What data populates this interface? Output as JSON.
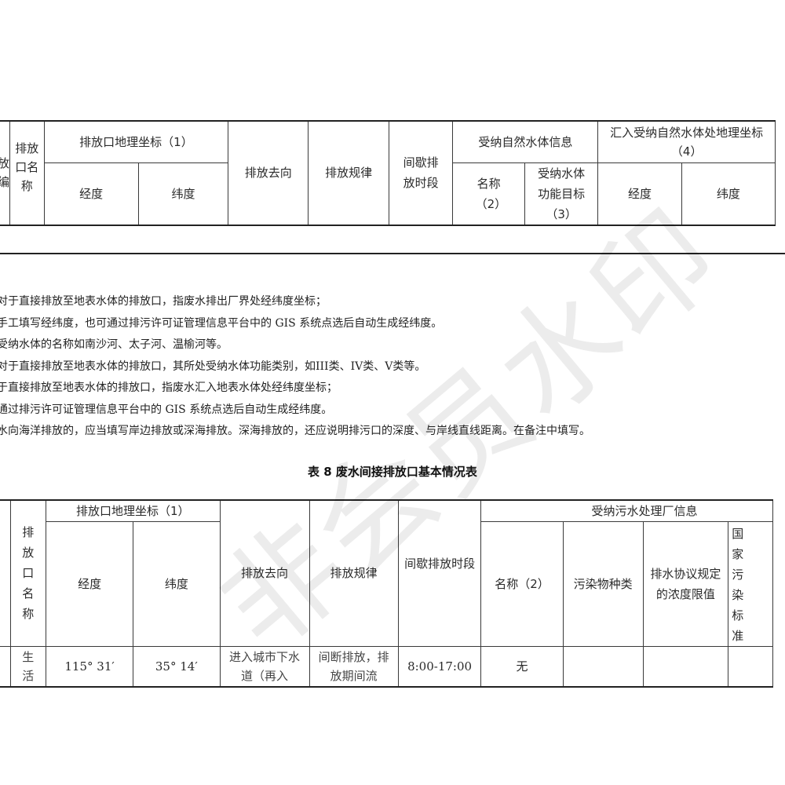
{
  "table7": {
    "headers": {
      "col_partial_number": "放编",
      "outlet_name": "排放口名称",
      "coords_group": "排放口地理坐标（1）",
      "longitude": "经度",
      "latitude": "纬度",
      "destination": "排放去向",
      "pattern": "排放规律",
      "intermittent_period": "间歇排放时段",
      "receiving_water_group": "受纳自然水体信息",
      "receiving_name": "名称（2）",
      "receiving_function": "受纳水体功能目标（3）",
      "inflow_coords_group": "汇入受纳自然水体处地理坐标（4）",
      "inflow_longitude": "经度",
      "inflow_latitude": "纬度"
    }
  },
  "notes": [
    "对于直接排放至地表水体的排放口，指废水排出厂界处经纬度坐标；",
    "手工填写经纬度，也可通过排污许可证管理信息平台中的 GIS 系统点选后自动生成经纬度。",
    "受纳水体的名称如南沙河、太子河、温榆河等。",
    "对于直接排放至地表水体的排放口，其所处受纳水体功能类别，如III类、IV类、V类等。",
    "于直接排放至地表水体的排放口，指废水汇入地表水体处经纬度坐标；",
    "通过排污许可证管理信息平台中的 GIS 系统点选后自动生成经纬度。",
    "水向海洋排放的，应当填写岸边排放或深海排放。深海排放的，还应说明排污口的深度、与岸线直线距离。在备注中填写。"
  ],
  "table8": {
    "caption": "表 8  废水间接排放口基本情况表",
    "headers": {
      "outlet_name": "排放口名称",
      "coords_group": "排放口地理坐标（1）",
      "longitude": "经度",
      "latitude": "纬度",
      "destination": "排放去向",
      "pattern": "排放规律",
      "intermittent_period": "间歇排放时段",
      "plant_group": "受纳污水处理厂信息",
      "plant_name": "名称（2）",
      "pollutant_type": "污染物种类",
      "agreement_limit": "排水协议规定的浓度限值",
      "national_standard": "国家污染标准"
    },
    "rows": [
      {
        "outlet_name": "生活",
        "longitude": "115° 31′",
        "latitude": "35° 14′",
        "destination": "进入城市下水道（再入",
        "pattern": "间断排放，排放期间流",
        "intermittent_period": "8:00-17:00",
        "plant_name": "无",
        "pollutant_type": "",
        "agreement_limit": "",
        "national_standard": ""
      }
    ]
  },
  "watermark": "非会员水印"
}
